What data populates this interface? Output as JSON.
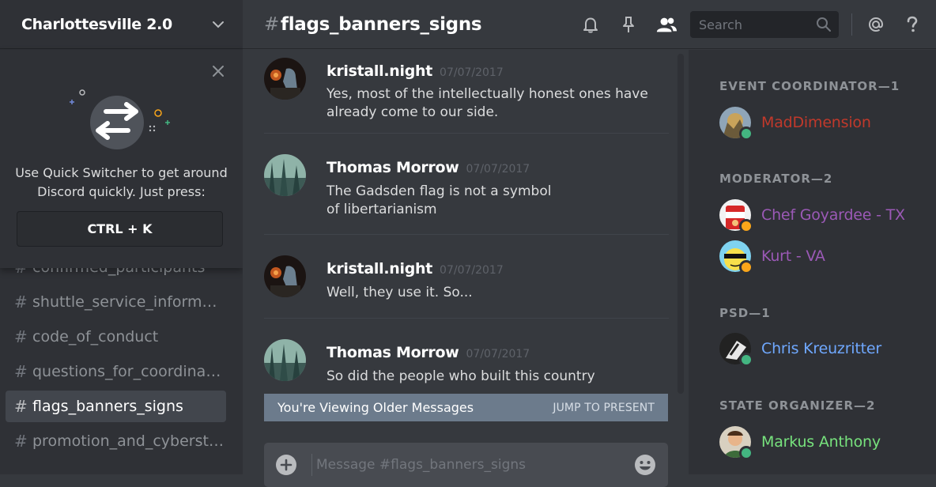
{
  "server": {
    "name": "Charlottesville 2.0"
  },
  "quick_switcher": {
    "text": "Use Quick Switcher to get around Discord quickly. Just press:",
    "shortcut": "CTRL + K"
  },
  "channels": [
    {
      "name": "confirmed_participants",
      "active": false
    },
    {
      "name": "shuttle_service_informat…",
      "active": false
    },
    {
      "name": "code_of_conduct",
      "active": false
    },
    {
      "name": "questions_for_coordinat…",
      "active": false
    },
    {
      "name": "flags_banners_signs",
      "active": true
    },
    {
      "name": "promotion_and_cyberstr…",
      "active": false
    }
  ],
  "channel_header": {
    "hash": "#",
    "name": "flags_banners_signs",
    "search_placeholder": "Search"
  },
  "messages": [
    {
      "author": "kristall.night",
      "time": "07/07/2017",
      "text": "Yes, most of the intellectually honest ones have already come to our side."
    },
    {
      "author": "Thomas Morrow",
      "time": "07/07/2017",
      "text": "The Gadsden flag is not a symbol of libertarianism"
    },
    {
      "author": "kristall.night",
      "time": "07/07/2017",
      "text": "Well, they use it. So..."
    },
    {
      "author": "Thomas Morrow",
      "time": "07/07/2017",
      "text": "So did the people who built this country"
    }
  ],
  "older_bar": {
    "label": "You're Viewing Older Messages",
    "jump": "JUMP TO PRESENT"
  },
  "composer": {
    "placeholder": "Message #flags_banners_signs"
  },
  "members": {
    "roles": [
      {
        "title": "EVENT COORDINATOR—1"
      },
      {
        "title": "MODERATOR—2"
      },
      {
        "title": "PSD—1"
      },
      {
        "title": "STATE ORGANIZER—2"
      }
    ],
    "people": [
      {
        "name": "MadDimension",
        "color": "#c1392b",
        "status": "online"
      },
      {
        "name": "Chef Goyardee - TX",
        "color": "#9b59b6",
        "status": "idle"
      },
      {
        "name": "Kurt - VA",
        "color": "#9b59b6",
        "status": "idle"
      },
      {
        "name": "Chris Kreuzritter",
        "color": "#6fa8ff",
        "status": "online"
      },
      {
        "name": "Markus Anthony",
        "color": "#77e27d",
        "status": "online"
      }
    ]
  },
  "colors": {
    "online": "#43b581",
    "idle": "#faa61a",
    "accent": "#7289da"
  }
}
